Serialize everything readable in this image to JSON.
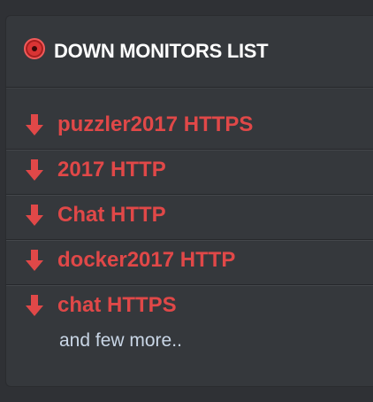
{
  "panel": {
    "title": "DOWN MONITORS LIST",
    "status_icon": "record-circle-icon",
    "accent_color": "#e04848"
  },
  "monitors": [
    {
      "name": "puzzler2017 HTTPS",
      "icon": "arrow-down-icon"
    },
    {
      "name": "2017 HTTP",
      "icon": "arrow-down-icon"
    },
    {
      "name": "Chat HTTP",
      "icon": "arrow-down-icon"
    },
    {
      "name": "docker2017 HTTP",
      "icon": "arrow-down-icon"
    },
    {
      "name": "chat HTTPS",
      "icon": "arrow-down-icon"
    }
  ],
  "more_text": "and few more.."
}
